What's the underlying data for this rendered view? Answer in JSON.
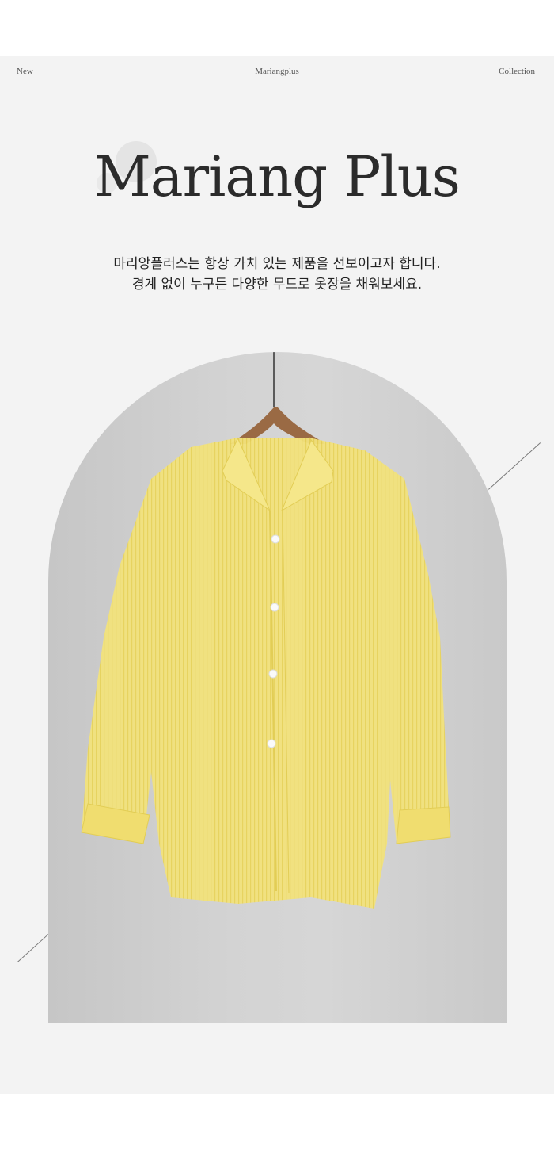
{
  "header": {
    "left_label": "New",
    "center_label": "Mariangplus",
    "right_label": "Collection"
  },
  "brand": {
    "title": "Mariang Plus"
  },
  "tagline": {
    "line1": "마리앙플러스는 항상 가치 있는 제품을 선보이고자 합니다.",
    "line2": "경계 없이 누구든 다양한 무드로 옷장을 채워보세요."
  },
  "product_image": {
    "icon": "shirt-illustration",
    "color": "#f2e27c"
  },
  "colors": {
    "panel_bg": "#f3f3f3",
    "arch_bg": "#d0d0d0",
    "shirt_yellow": "#f2e27c",
    "hanger_wood": "#9a6a44"
  }
}
